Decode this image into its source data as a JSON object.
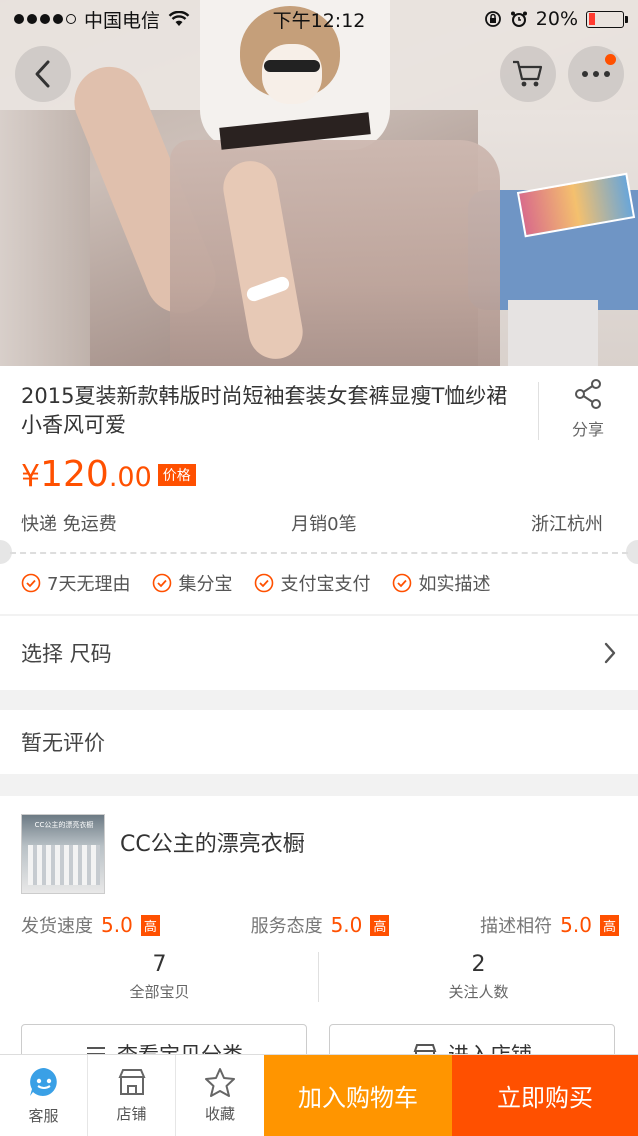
{
  "status_bar": {
    "carrier": "中国电信",
    "time": "下午12:12",
    "battery": "20%",
    "battery_level": 0.2
  },
  "product": {
    "title": "2015夏装新款韩版时尚短袖套装女套裤显瘦T恤纱裙小香风可爱",
    "share_label": "分享",
    "price_symbol": "¥",
    "price_integer": "120",
    "price_decimal": ".00",
    "price_tag": "价格",
    "shipping": "快递 免运费",
    "monthly_sales": "月销0笔",
    "location": "浙江杭州",
    "guarantees": [
      "7天无理由",
      "集分宝",
      "支付宝支付",
      "如实描述"
    ]
  },
  "options": {
    "select_label": "选择 尺码",
    "reviews_label": "暂无评价"
  },
  "shop": {
    "name": "CC公主的漂亮衣橱",
    "logo_text": "CC公主的漂亮衣橱",
    "ratings": [
      {
        "label": "发货速度",
        "score": "5.0",
        "badge": "高"
      },
      {
        "label": "服务态度",
        "score": "5.0",
        "badge": "高"
      },
      {
        "label": "描述相符",
        "score": "5.0",
        "badge": "高"
      }
    ],
    "stats": [
      {
        "num": "7",
        "label": "全部宝贝"
      },
      {
        "num": "2",
        "label": "关注人数"
      }
    ],
    "buttons": [
      "查看宝贝分类",
      "进入店铺"
    ]
  },
  "bottom_bar": {
    "tabs": [
      {
        "label": "客服",
        "icon": "service-chat-icon"
      },
      {
        "label": "店铺",
        "icon": "shop-icon"
      },
      {
        "label": "收藏",
        "icon": "star-icon"
      }
    ],
    "add_to_cart": "加入购物车",
    "buy_now": "立即购买"
  },
  "colors": {
    "accent": "#ff5000",
    "cart_button": "#ff9500",
    "service_icon": "#3aa0e6"
  }
}
